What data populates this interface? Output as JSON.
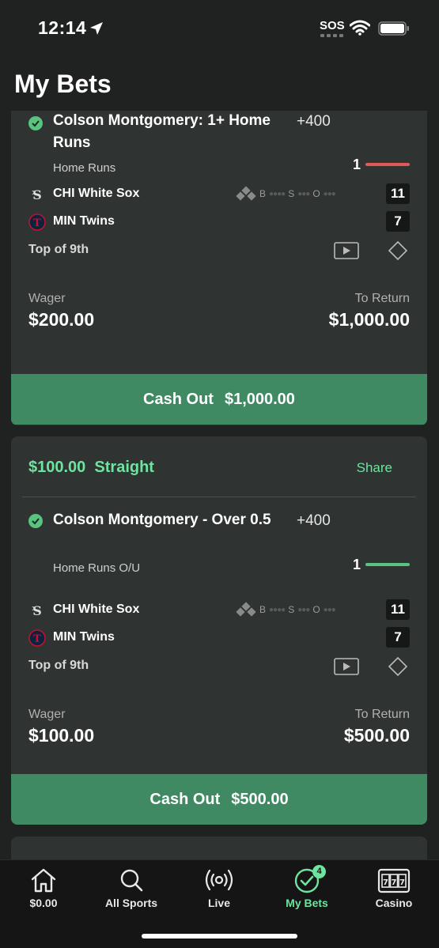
{
  "status_bar": {
    "time": "12:14",
    "sos": "SOS"
  },
  "page": {
    "title": "My Bets"
  },
  "bets": [
    {
      "bet_type": "",
      "selection": "Colson Montgomery: 1+ Home Runs",
      "odds": "+400",
      "market": "Home Runs",
      "progress_value": "1",
      "progress_color": "#e05a5a",
      "team_away": "CHI White Sox",
      "team_home": "MIN Twins",
      "score_away": "11",
      "score_home": "7",
      "count": {
        "b": "B",
        "s": "S",
        "o": "O"
      },
      "inning": "Top of 9th",
      "wager_label": "Wager",
      "wager": "$200.00",
      "return_label": "To Return",
      "to_return": "$1,000.00",
      "cashout_label": "Cash Out",
      "cashout_amount": "$1,000.00"
    },
    {
      "bet_type": "$100.00  Straight",
      "share_label": "Share",
      "selection": "Colson Montgomery - Over 0.5",
      "odds": "+400",
      "market": "Home Runs O/U",
      "progress_value": "1",
      "progress_color": "#58c47f",
      "team_away": "CHI White Sox",
      "team_home": "MIN Twins",
      "score_away": "11",
      "score_home": "7",
      "count": {
        "b": "B",
        "s": "S",
        "o": "O"
      },
      "inning": "Top of 9th",
      "wager_label": "Wager",
      "wager": "$100.00",
      "return_label": "To Return",
      "to_return": "$500.00",
      "cashout_label": "Cash Out",
      "cashout_amount": "$500.00"
    }
  ],
  "tab_bar": {
    "tabs": [
      {
        "label": "$0.00",
        "icon": "home-icon"
      },
      {
        "label": "All Sports",
        "icon": "search-icon"
      },
      {
        "label": "Live",
        "icon": "broadcast-icon"
      },
      {
        "label": "My Bets",
        "icon": "check-circle-icon",
        "badge": "4",
        "active": true
      },
      {
        "label": "Casino",
        "icon": "slot-machine-icon"
      }
    ]
  },
  "colors": {
    "accent": "#6fe3a0",
    "cashout": "#3f8a63",
    "loss_bar": "#e05a5a"
  }
}
